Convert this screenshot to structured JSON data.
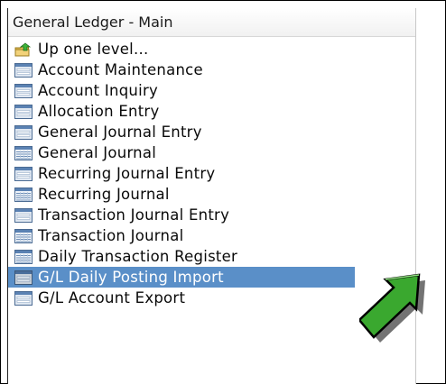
{
  "panel": {
    "title": "General Ledger - Main"
  },
  "menu": {
    "items": [
      {
        "label": "Up one level...",
        "icon": "folder-up-icon"
      },
      {
        "label": "Account Maintenance",
        "icon": "form-icon"
      },
      {
        "label": "Account Inquiry",
        "icon": "form-icon"
      },
      {
        "label": "Allocation Entry",
        "icon": "form-icon"
      },
      {
        "label": "General Journal Entry",
        "icon": "form-icon"
      },
      {
        "label": "General Journal",
        "icon": "report-icon"
      },
      {
        "label": "Recurring Journal Entry",
        "icon": "form-icon"
      },
      {
        "label": "Recurring Journal",
        "icon": "report-icon"
      },
      {
        "label": "Transaction Journal Entry",
        "icon": "form-icon"
      },
      {
        "label": "Transaction Journal",
        "icon": "report-icon"
      },
      {
        "label": "Daily Transaction Register",
        "icon": "report-icon"
      },
      {
        "label": "G/L Daily Posting Import",
        "icon": "form-icon",
        "selected": true
      },
      {
        "label": "G/L Account Export",
        "icon": "form-icon"
      }
    ]
  },
  "colors": {
    "selection": "#5a8fc8",
    "arrow_fill": "#3aa82f",
    "arrow_outline": "#000000"
  }
}
